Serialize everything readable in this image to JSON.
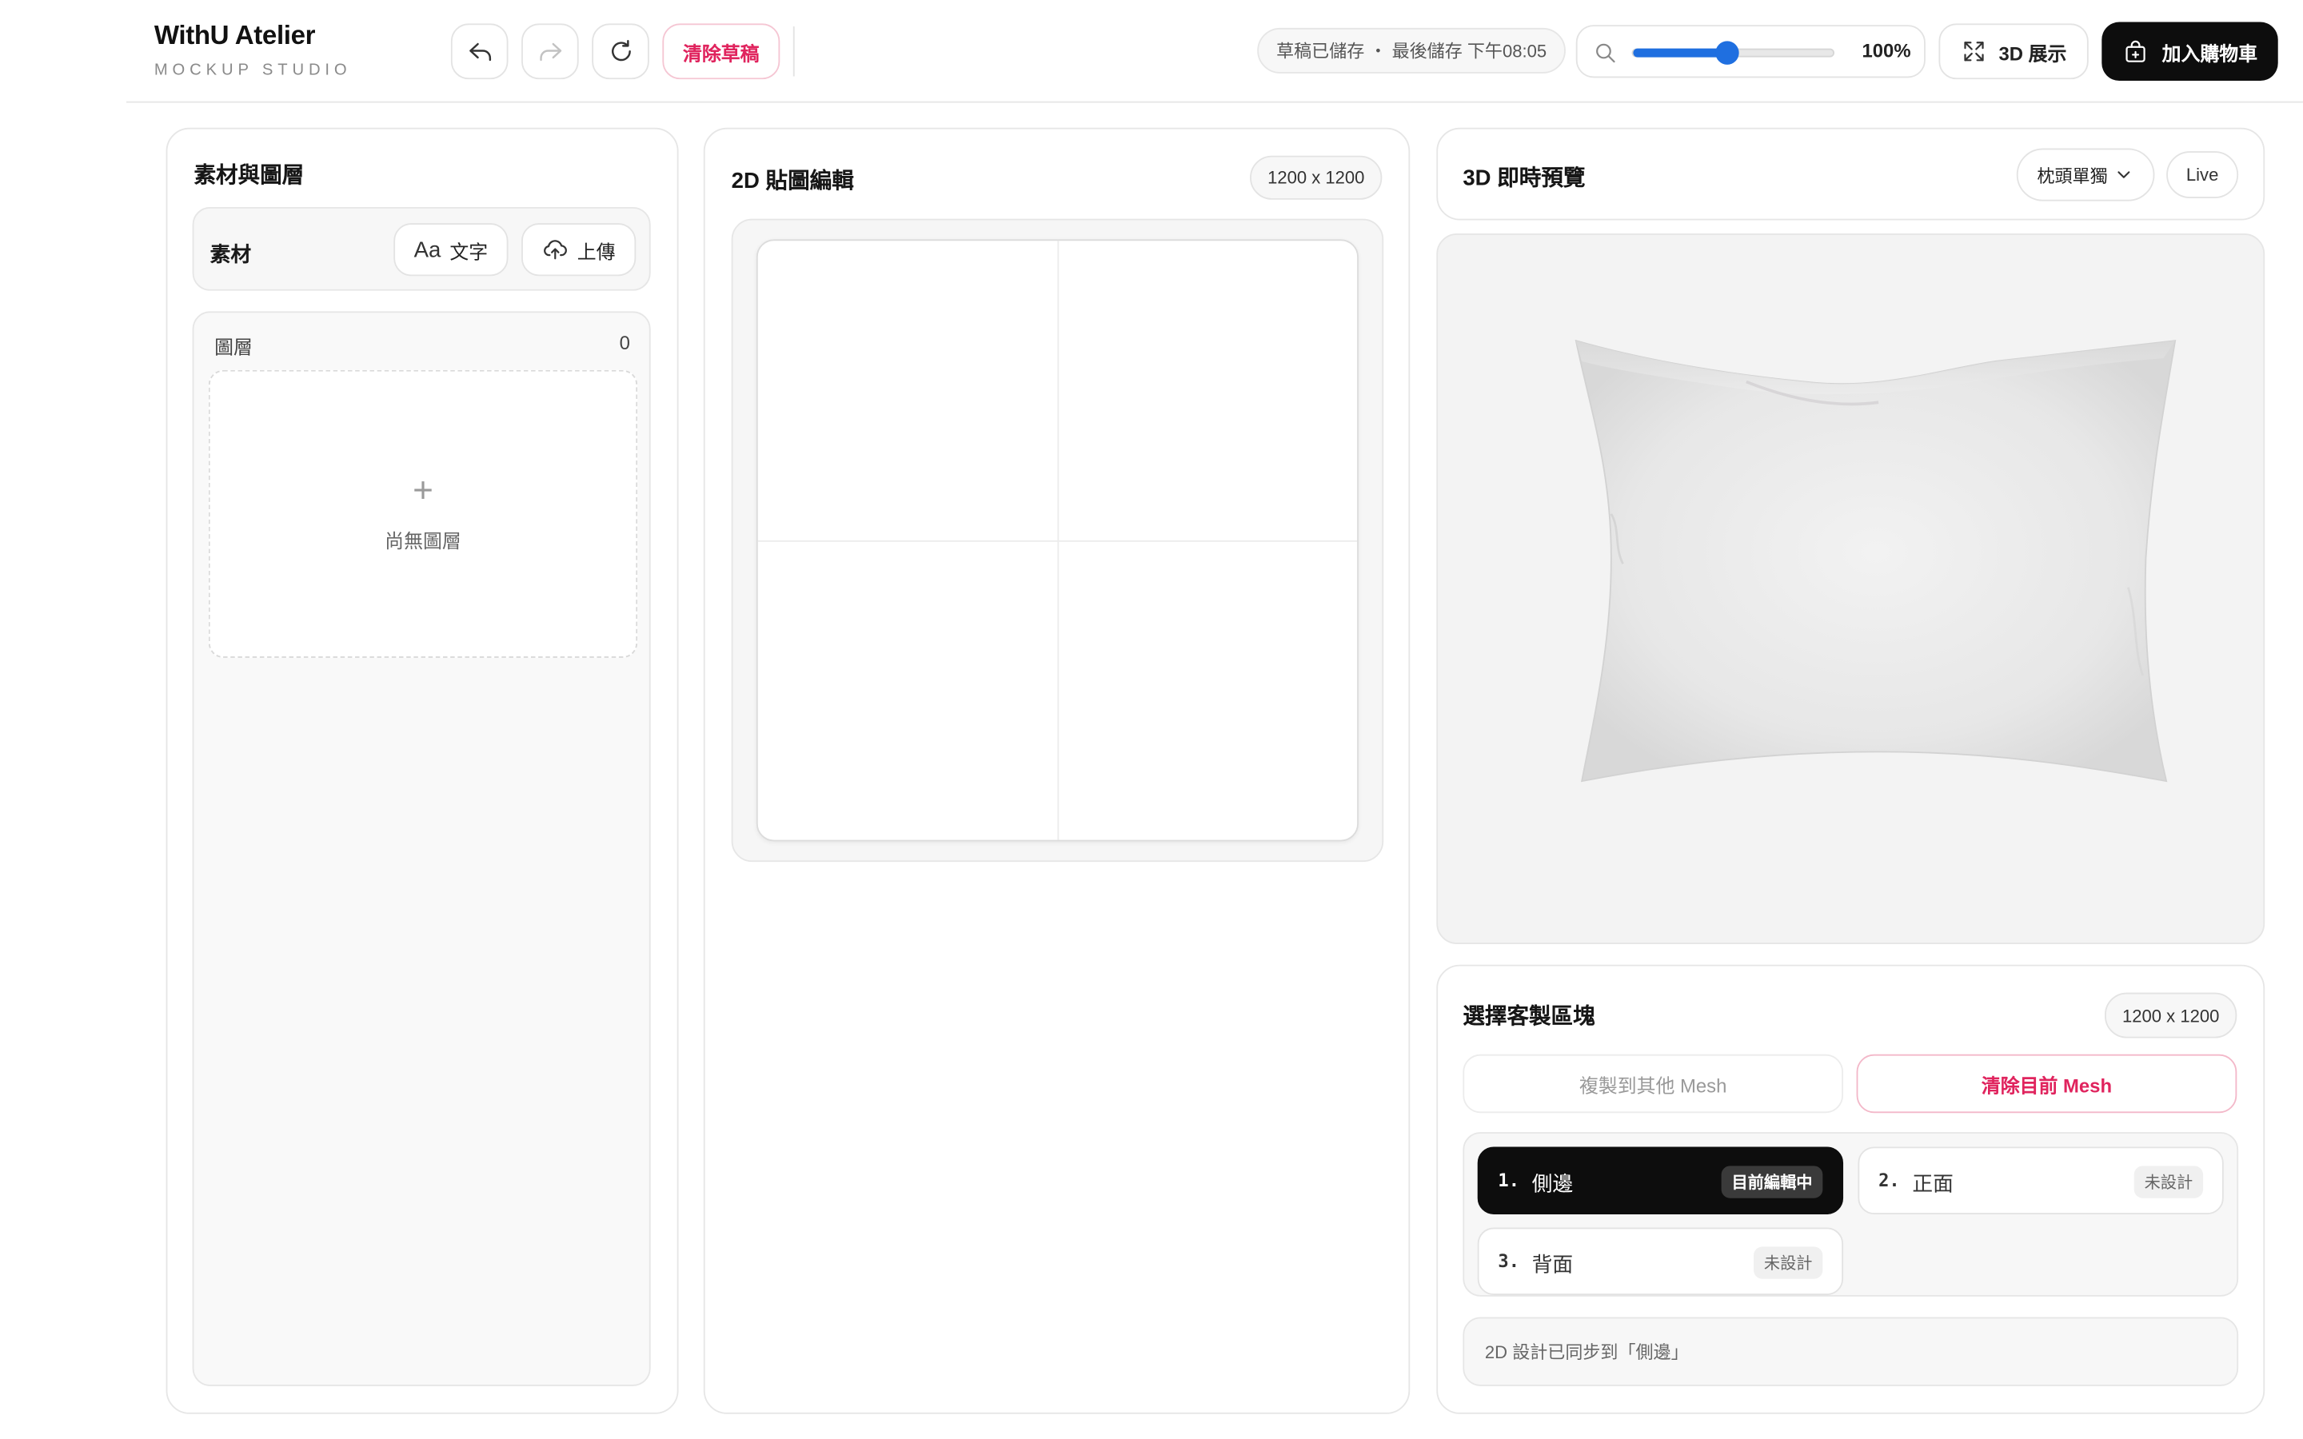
{
  "header": {
    "brand_title": "WithU Atelier",
    "brand_subtitle": "MOCKUP STUDIO",
    "undo_icon": "undo-icon",
    "redo_icon": "redo-icon",
    "refresh_icon": "refresh-icon",
    "clear_draft_label": "清除草稿",
    "save_status": "草稿已儲存 ・ 最後儲存 下午08:05",
    "zoom": {
      "icon": "search-icon",
      "value_text": "100%",
      "slider_fraction": 0.47
    },
    "view_3d_label": "3D 展示",
    "view_3d_icon": "expand-icon",
    "cart_label": "加入購物車",
    "cart_icon": "shopping-bag-icon",
    "accent_color": "#1f6fe0",
    "danger_color": "#e0245e"
  },
  "left_panel": {
    "title": "素材與圖層",
    "assets_label": "素材",
    "text_button_glyph": "Aa",
    "text_button_label": "文字",
    "upload_button_label": "上傳",
    "upload_icon": "cloud-upload-icon",
    "layers_label": "圖層",
    "layers_count": "0",
    "empty_plus": "+",
    "empty_text": "尚無圖層"
  },
  "middle_panel": {
    "title": "2D 貼圖編輯",
    "size_badge": "1200 x 1200"
  },
  "right_panel": {
    "title": "3D 即時預覽",
    "product_select": "枕頭單獨",
    "live_badge": "Live",
    "region_title": "選擇客製區塊",
    "region_size_badge": "1200 x 1200",
    "copy_mesh_label": "複製到其他 Mesh",
    "clear_mesh_label": "清除目前 Mesh",
    "regions": [
      {
        "num": "1.",
        "name": "側邊",
        "badge": "目前編輯中",
        "active": true
      },
      {
        "num": "2.",
        "name": "正面",
        "badge": "未設計",
        "active": false
      },
      {
        "num": "3.",
        "name": "背面",
        "badge": "未設計",
        "active": false
      }
    ],
    "sync_message": "2D 設計已同步到「側邊」"
  }
}
